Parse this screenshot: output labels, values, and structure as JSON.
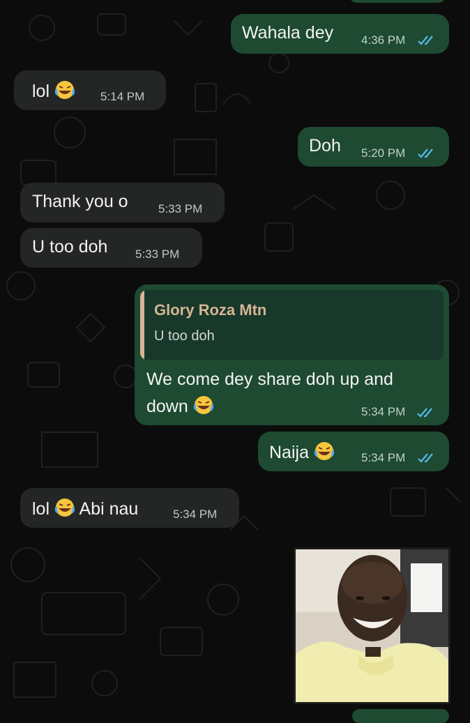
{
  "chat": {
    "messages": [
      {
        "id": "m1",
        "direction": "outgoing",
        "text": "Wahala dey",
        "time": "4:36 PM",
        "status": "read"
      },
      {
        "id": "m2",
        "direction": "incoming",
        "text": "lol",
        "emoji": "face-with-tears-of-joy",
        "time": "5:14 PM"
      },
      {
        "id": "m3",
        "direction": "outgoing",
        "text": "Doh",
        "time": "5:20 PM",
        "status": "read"
      },
      {
        "id": "m4",
        "direction": "incoming",
        "text": "Thank you o",
        "time": "5:33 PM"
      },
      {
        "id": "m5",
        "direction": "incoming",
        "text": "U too doh",
        "time": "5:33 PM"
      },
      {
        "id": "m6",
        "direction": "outgoing",
        "reply_to": {
          "author": "Glory Roza Mtn",
          "text": "U too doh"
        },
        "text_line1": "We come dey share doh up and",
        "text_line2": "down",
        "emoji": "face-with-tears-of-joy",
        "time": "5:34 PM",
        "status": "read"
      },
      {
        "id": "m7",
        "direction": "outgoing",
        "text": "Naija",
        "emoji": "face-with-tears-of-joy",
        "time": "5:34 PM",
        "status": "read"
      },
      {
        "id": "m8",
        "direction": "incoming",
        "text": "lol",
        "text_after": "Abi nau",
        "emoji": "face-with-tears-of-joy",
        "time": "5:34 PM"
      },
      {
        "id": "m9",
        "direction": "incoming",
        "type": "sticker-image",
        "subject": "smiling man in yellow shirt"
      }
    ]
  },
  "colors": {
    "background": "#0b0c0b",
    "incoming_bubble": "#242626",
    "outgoing_bubble": "#1e4a32",
    "read_ticks": "#53bdeb",
    "quote_accent": "#d7b596"
  },
  "icons": [
    "double-check-icon",
    "laughing-emoji",
    "chat-doodle-pattern"
  ]
}
